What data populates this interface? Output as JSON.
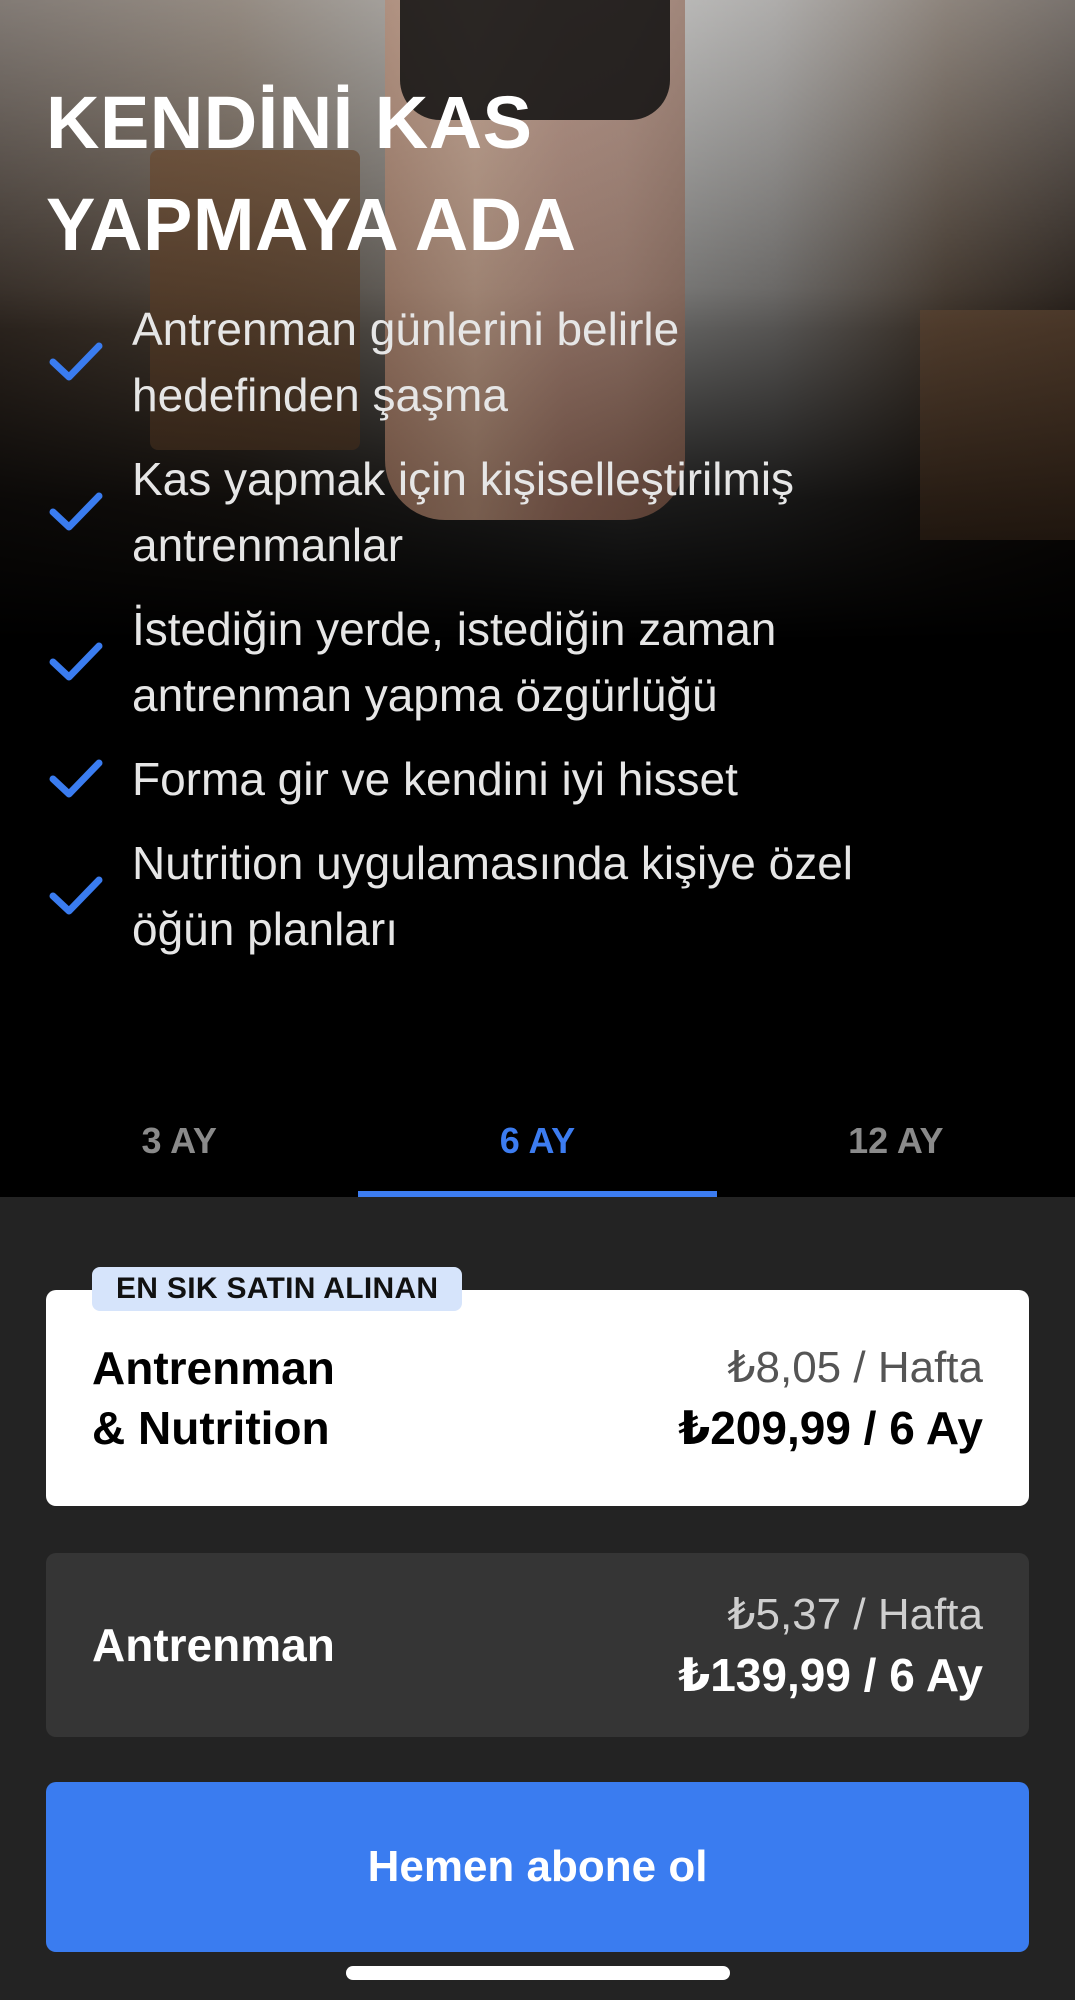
{
  "hero": {
    "title_line1": "KENDİNİ KAS",
    "title_line2": "YAPMAYA ADA",
    "features": [
      {
        "icon": "check-icon",
        "text_line1": "Antrenman günlerini belirle",
        "text_line2": "hedefinden şaşma"
      },
      {
        "icon": "check-icon",
        "text_line1": "Kas yapmak için kişiselleştirilmiş",
        "text_line2": "antrenmanlar"
      },
      {
        "icon": "check-icon",
        "text_line1": "İstediğin yerde, istediğin zaman",
        "text_line2": "antrenman yapma özgürlüğü"
      },
      {
        "icon": "check-icon",
        "text_line1": "Forma gir ve kendini iyi hisset",
        "text_line2": ""
      },
      {
        "icon": "check-icon",
        "text_line1": "Nutrition uygulamasında kişiye özel",
        "text_line2": "öğün planları"
      }
    ]
  },
  "tabs": [
    {
      "label": "3 AY",
      "active": false
    },
    {
      "label": "6 AY",
      "active": true
    },
    {
      "label": "12 AY",
      "active": false
    }
  ],
  "plans": {
    "selected": {
      "badge": "EN SIK SATIN ALINAN",
      "name_line1": "Antrenman",
      "name_line2": "& Nutrition",
      "price_week": "₺8,05 / Hafta",
      "price_total": "₺209,99 / 6 Ay"
    },
    "other": {
      "name": "Antrenman",
      "price_week": "₺5,37 / Hafta",
      "price_total": "₺139,99 / 6 Ay"
    }
  },
  "cta": {
    "label": "Hemen abone ol"
  },
  "colors": {
    "accent": "#3a7cf0",
    "panel": "#232323",
    "badge_bg": "#d6e4fb"
  }
}
